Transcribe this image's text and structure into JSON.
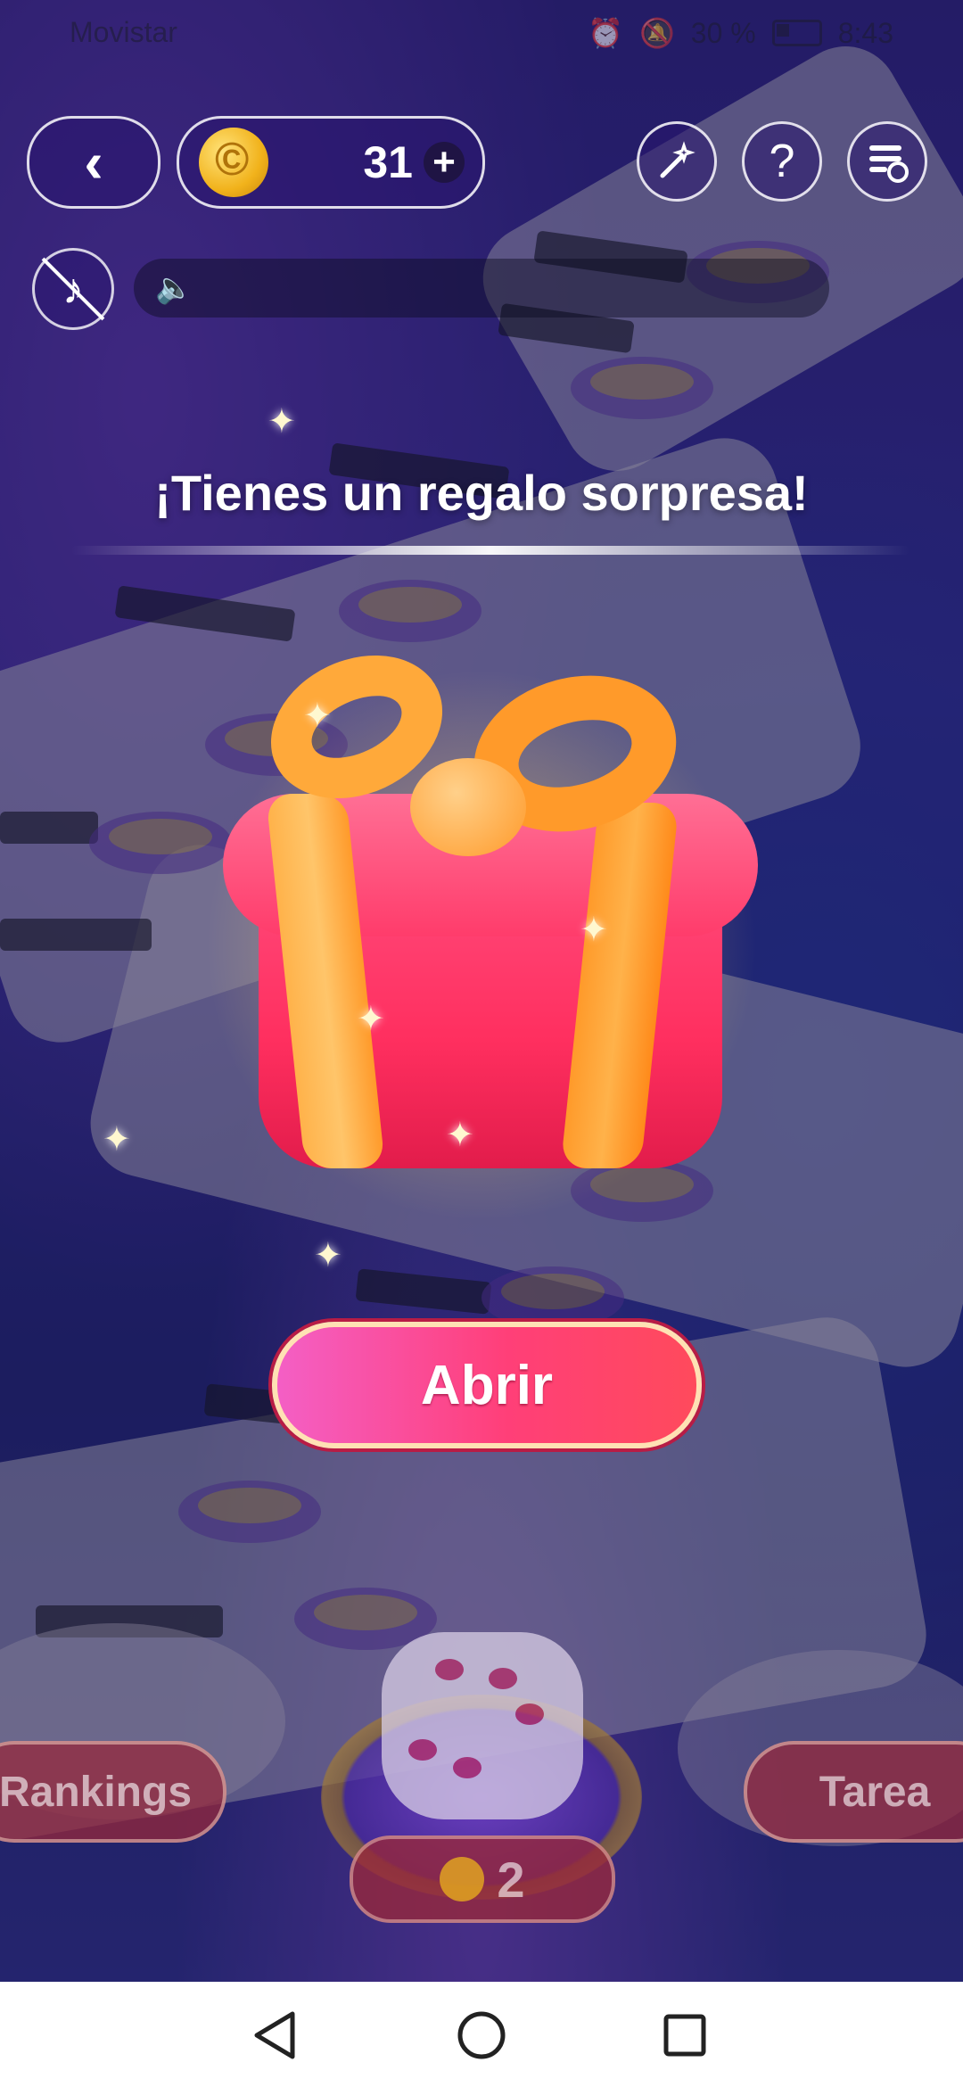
{
  "status_bar": {
    "carrier": "Movistar",
    "battery": "30 %",
    "time": "8:43"
  },
  "top_bar": {
    "back_icon": "‹",
    "coins": "31",
    "plus_icon": "+",
    "help_icon": "?"
  },
  "popup": {
    "title": "¡Tienes un regalo sorpresa!",
    "open_label": "Abrir"
  },
  "bottom": {
    "rankings_label": "Rankings",
    "task_label": "Tarea",
    "roll_cost": "2"
  }
}
